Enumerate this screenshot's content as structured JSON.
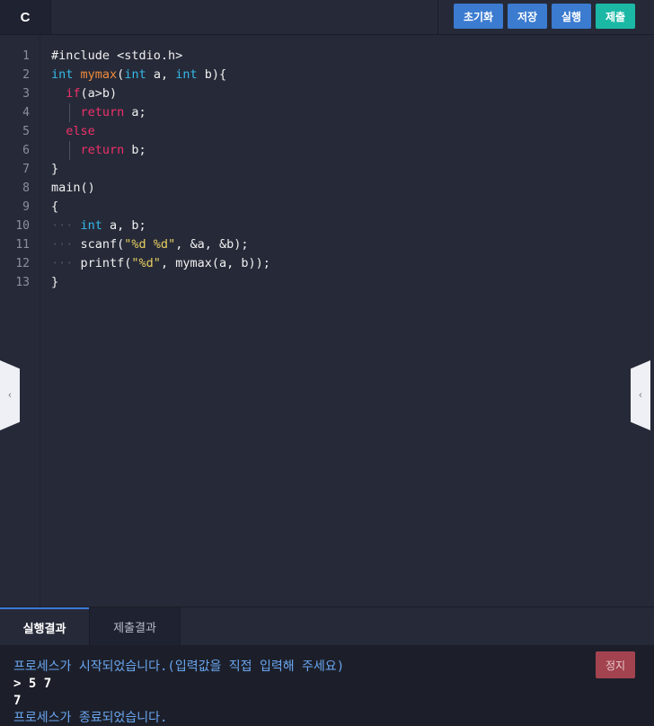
{
  "language_tab": "C",
  "toolbar": {
    "reset_label": "초기화",
    "save_label": "저장",
    "run_label": "실행",
    "submit_label": "제출"
  },
  "colors": {
    "button_blue": "#3b7bd0",
    "button_teal": "#1cb8a6",
    "stop_red": "#a2434f",
    "editor_bg": "#262a38"
  },
  "editor": {
    "line_numbers": [
      "1",
      "2",
      "3",
      "4",
      "5",
      "6",
      "7",
      "8",
      "9",
      "10",
      "11",
      "12",
      "13"
    ],
    "lines": [
      "#include <stdio.h>",
      "int mymax(int a, int b){",
      "  if(a>b)",
      "    return a;",
      "  else",
      "    return b;",
      "}",
      "main()",
      "{",
      "    int a, b;",
      "    scanf(\"%d %d\", &a, &b);",
      "    printf(\"%d\", mymax(a, b));",
      "}"
    ]
  },
  "side_handles": {
    "left_icon": "chevron-left-icon",
    "right_icon": "chevron-left-icon",
    "glyph": "‹"
  },
  "result_tabs": {
    "run_result": "실행결과",
    "submit_result": "제출결과"
  },
  "console": {
    "start_msg": "프로세스가 시작되었습니다.(입력값을 직접 입력해 주세요)",
    "input_line": "> 5 7",
    "output_line": "7",
    "end_msg": "프로세스가 종료되었습니다."
  },
  "stop_button": "정지"
}
